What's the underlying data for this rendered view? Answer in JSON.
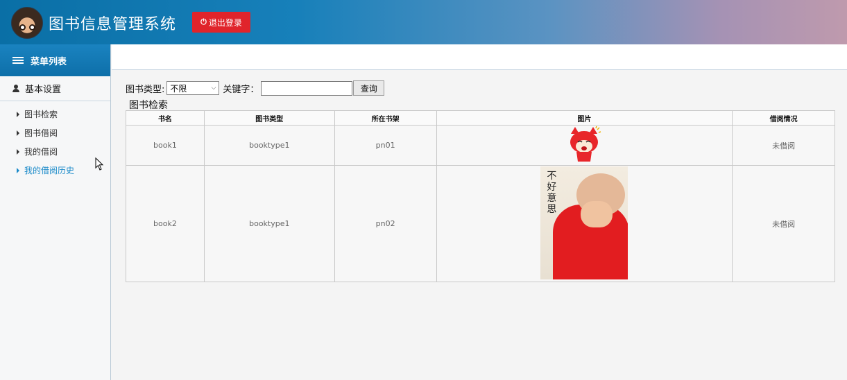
{
  "header": {
    "title": "图书信息管理系统",
    "logout_label": "退出登录"
  },
  "sidebar": {
    "menu_title": "菜单列表",
    "section_title": "基本设置",
    "items": [
      {
        "label": "图书检索",
        "active": false
      },
      {
        "label": "图书借阅",
        "active": false
      },
      {
        "label": "我的借阅",
        "active": false
      },
      {
        "label": "我的借阅历史",
        "active": true
      }
    ]
  },
  "search": {
    "type_label": "图书类型:",
    "type_selected": "不限",
    "keyword_label": "关键字：",
    "keyword_value": "",
    "query_label": "查询"
  },
  "section_title": "图书检索",
  "table": {
    "columns": [
      "书名",
      "图书类型",
      "所在书架",
      "图片",
      "借阅情况"
    ],
    "rows": [
      {
        "name": "book1",
        "type": "booktype1",
        "shelf": "pn01",
        "image": "red-fox-cartoon",
        "status": "未借阅"
      },
      {
        "name": "book2",
        "type": "booktype1",
        "shelf": "pn02",
        "image": "baby-covering-face-photo",
        "status": "未借阅"
      }
    ]
  },
  "photo_caption": "不好意思",
  "colors": {
    "header_start": "#0a6fa6",
    "header_end": "#bf9aad",
    "logout": "#e0242b",
    "menu_header": "#1a83c0",
    "active_link": "#1a8ac9"
  },
  "icons": {
    "logout": "power-icon",
    "menu": "list-icon",
    "section": "user-icon",
    "nav": "caret-right-icon"
  }
}
